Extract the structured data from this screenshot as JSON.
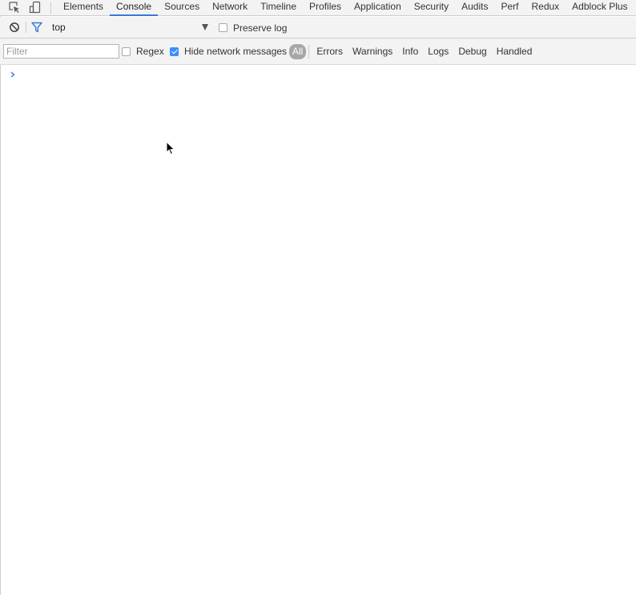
{
  "tabbar": {
    "icons": [
      "inspect-element-icon",
      "device-toolbar-icon"
    ],
    "tabs": [
      {
        "label": "Elements",
        "active": false
      },
      {
        "label": "Console",
        "active": true
      },
      {
        "label": "Sources",
        "active": false
      },
      {
        "label": "Network",
        "active": false
      },
      {
        "label": "Timeline",
        "active": false
      },
      {
        "label": "Profiles",
        "active": false
      },
      {
        "label": "Application",
        "active": false
      },
      {
        "label": "Security",
        "active": false
      },
      {
        "label": "Audits",
        "active": false
      },
      {
        "label": "Perf",
        "active": false
      },
      {
        "label": "Redux",
        "active": false
      },
      {
        "label": "Adblock Plus",
        "active": false
      }
    ],
    "accent_color": "#3879d9"
  },
  "toolbar": {
    "clear_icon": "clear-console-icon",
    "filter_icon": "filter-icon",
    "filter_icon_color": "#3879d9",
    "context": "top",
    "preserve_log": {
      "label": "Preserve log",
      "checked": false
    }
  },
  "filterbar": {
    "filter_placeholder": "Filter",
    "filter_value": "",
    "regex": {
      "label": "Regex",
      "checked": false
    },
    "hide_network": {
      "label": "Hide network messages",
      "checked": true
    },
    "levels": [
      {
        "label": "All",
        "active": true
      },
      {
        "label": "Errors",
        "active": false
      },
      {
        "label": "Warnings",
        "active": false
      },
      {
        "label": "Info",
        "active": false
      },
      {
        "label": "Logs",
        "active": false
      },
      {
        "label": "Debug",
        "active": false
      },
      {
        "label": "Handled",
        "active": false
      }
    ]
  },
  "console": {
    "prompt_icon": "chevron-right-icon",
    "prompt_color": "#3879d9",
    "input_value": ""
  }
}
